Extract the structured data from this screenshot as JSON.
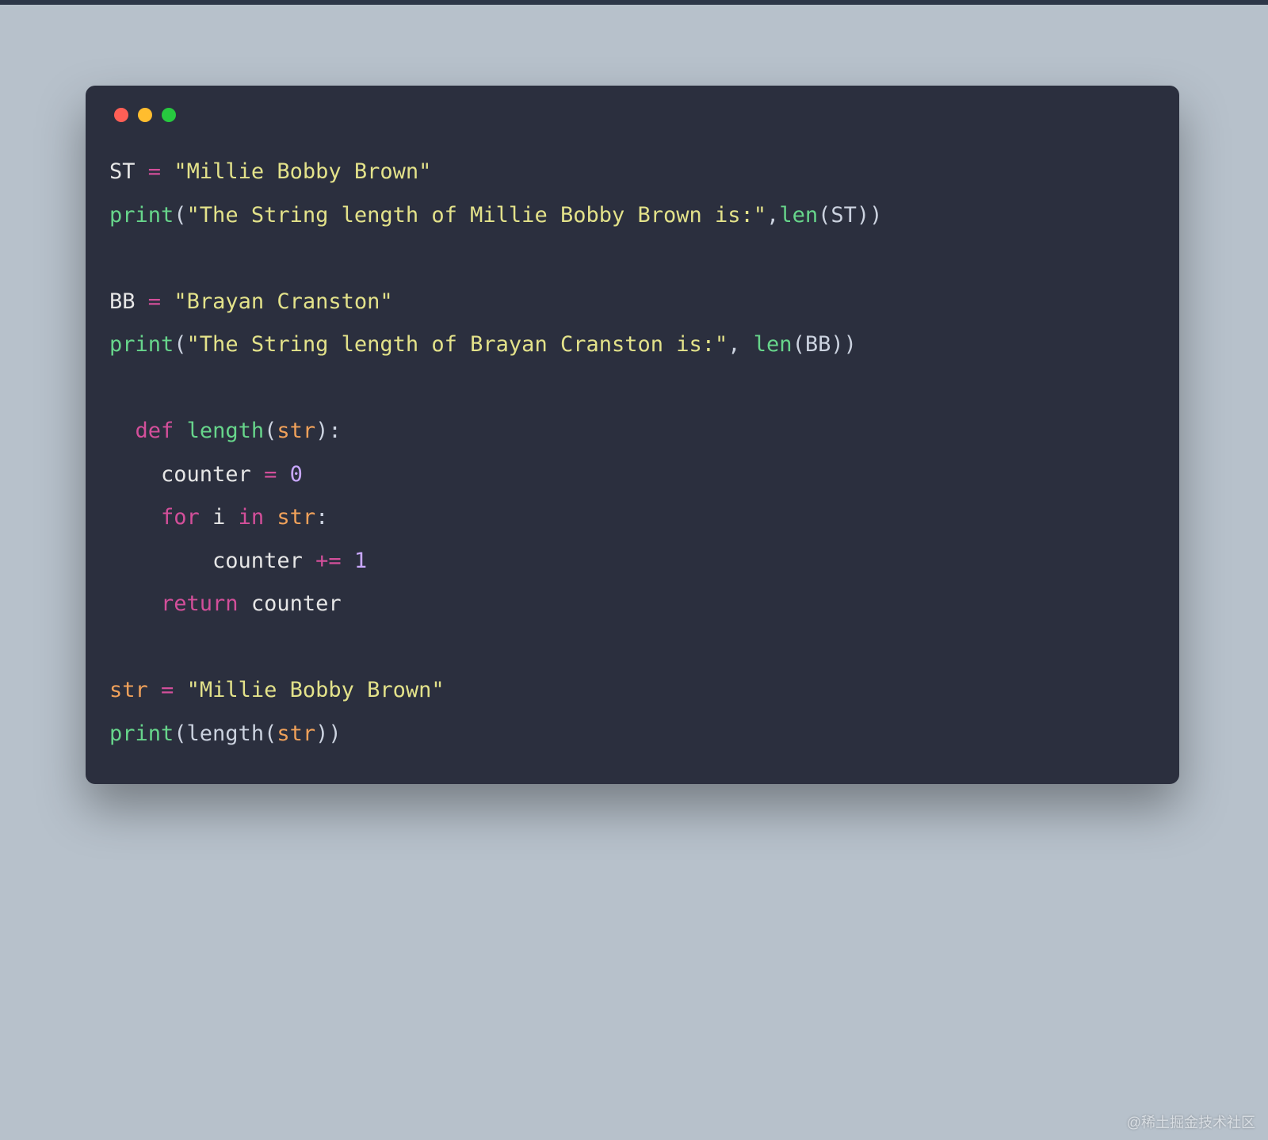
{
  "colors": {
    "page_bg": "#b7c1cb",
    "card_bg": "#2b2f3e",
    "traffic": {
      "red": "#ff5f56",
      "yellow": "#ffbd2e",
      "green": "#27c93f"
    },
    "syntax": {
      "variable": "#e6e6e6",
      "operator": "#d34f9a",
      "string": "#e3e28a",
      "function": "#67d58b",
      "punct": "#cbd2df",
      "keyword": "#d34f9a",
      "defname": "#67d58b",
      "param": "#f0a15a",
      "number": "#c9a8ff"
    }
  },
  "watermark": "@稀土掘金技术社区",
  "code_lines": [
    [
      {
        "t": "ST ",
        "c": "var"
      },
      {
        "t": "=",
        "c": "op"
      },
      {
        "t": " ",
        "c": "punc"
      },
      {
        "t": "\"Millie Bobby Brown\"",
        "c": "str"
      }
    ],
    [
      {
        "t": "print",
        "c": "func"
      },
      {
        "t": "(",
        "c": "punc"
      },
      {
        "t": "\"The String length of Millie Bobby Brown is:\"",
        "c": "str"
      },
      {
        "t": ",",
        "c": "punc"
      },
      {
        "t": "len",
        "c": "func"
      },
      {
        "t": "(ST))",
        "c": "punc"
      }
    ],
    [],
    [
      {
        "t": "BB ",
        "c": "var"
      },
      {
        "t": "=",
        "c": "op"
      },
      {
        "t": " ",
        "c": "punc"
      },
      {
        "t": "\"Brayan Cranston\"",
        "c": "str"
      }
    ],
    [
      {
        "t": "print",
        "c": "func"
      },
      {
        "t": "(",
        "c": "punc"
      },
      {
        "t": "\"The String length of Brayan Cranston is:\"",
        "c": "str"
      },
      {
        "t": ", ",
        "c": "punc"
      },
      {
        "t": "len",
        "c": "func"
      },
      {
        "t": "(BB))",
        "c": "punc"
      }
    ],
    [],
    [
      {
        "t": "  ",
        "c": "punc"
      },
      {
        "t": "def",
        "c": "kw"
      },
      {
        "t": " ",
        "c": "punc"
      },
      {
        "t": "length",
        "c": "def"
      },
      {
        "t": "(",
        "c": "punc"
      },
      {
        "t": "str",
        "c": "param"
      },
      {
        "t": "):",
        "c": "punc"
      }
    ],
    [
      {
        "t": "    counter ",
        "c": "var"
      },
      {
        "t": "=",
        "c": "op"
      },
      {
        "t": " ",
        "c": "punc"
      },
      {
        "t": "0",
        "c": "num"
      }
    ],
    [
      {
        "t": "    ",
        "c": "punc"
      },
      {
        "t": "for",
        "c": "kw"
      },
      {
        "t": " i ",
        "c": "var"
      },
      {
        "t": "in",
        "c": "kw"
      },
      {
        "t": " ",
        "c": "punc"
      },
      {
        "t": "str",
        "c": "param"
      },
      {
        "t": ":",
        "c": "punc"
      }
    ],
    [
      {
        "t": "        counter ",
        "c": "var"
      },
      {
        "t": "+=",
        "c": "op"
      },
      {
        "t": " ",
        "c": "punc"
      },
      {
        "t": "1",
        "c": "num"
      }
    ],
    [
      {
        "t": "    ",
        "c": "punc"
      },
      {
        "t": "return",
        "c": "kw"
      },
      {
        "t": " counter",
        "c": "var"
      }
    ],
    [],
    [
      {
        "t": "str",
        "c": "param"
      },
      {
        "t": " ",
        "c": "punc"
      },
      {
        "t": "=",
        "c": "op"
      },
      {
        "t": " ",
        "c": "punc"
      },
      {
        "t": "\"Millie Bobby Brown\"",
        "c": "str"
      }
    ],
    [
      {
        "t": "print",
        "c": "func"
      },
      {
        "t": "(length(",
        "c": "punc"
      },
      {
        "t": "str",
        "c": "param"
      },
      {
        "t": "))",
        "c": "punc"
      }
    ]
  ]
}
